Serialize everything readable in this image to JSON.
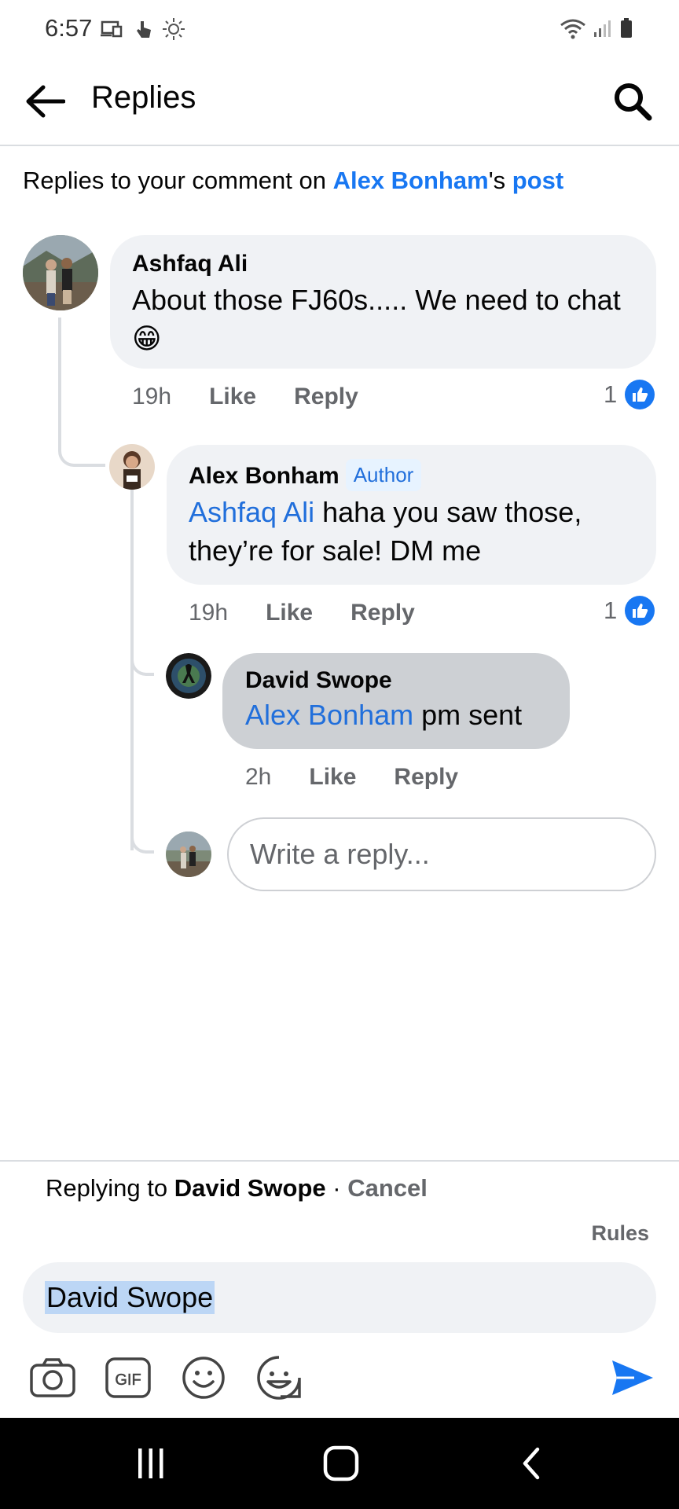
{
  "status_bar": {
    "time": "6:57",
    "icons_left": [
      "screen-cast-icon",
      "touch-icon",
      "sun-icon"
    ],
    "icons_right": [
      "wifi-icon",
      "signal-icon",
      "battery-icon"
    ]
  },
  "header": {
    "title": "Replies",
    "back_icon": "arrow-left-icon",
    "search_icon": "search-icon"
  },
  "context": {
    "prefix": "Replies to your comment on ",
    "person": "Alex Bonham",
    "possessive": "'s ",
    "post_link": "post"
  },
  "comments": [
    {
      "author": "Ashfaq Ali",
      "text": "About those FJ60s..... We need to chat",
      "emoji": "😁",
      "time": "19h",
      "like_label": "Like",
      "reply_label": "Reply",
      "like_count": "1"
    },
    {
      "author": "Alex Bonham",
      "badge": "Author",
      "mention": "Ashfaq Ali",
      "text": " haha you saw those, they’re for sale! DM me",
      "time": "19h",
      "like_label": "Like",
      "reply_label": "Reply",
      "like_count": "1"
    },
    {
      "author": "David Swope",
      "mention": "Alex Bonham",
      "text": " pm sent",
      "time": "2h",
      "like_label": "Like",
      "reply_label": "Reply"
    }
  ],
  "reply_input": {
    "placeholder": "Write a reply..."
  },
  "composer": {
    "replying_prefix": "Replying to ",
    "replying_name": "David Swope",
    "separator": " · ",
    "cancel_label": "Cancel",
    "rules_label": "Rules",
    "input_value": "David Swope",
    "tools": [
      "camera-icon",
      "gif-icon",
      "emoji-icon",
      "sticker-icon"
    ],
    "send_icon": "send-icon"
  },
  "nav": {
    "buttons": [
      "recent-apps-icon",
      "home-icon",
      "back-icon"
    ]
  },
  "colors": {
    "accent": "#1877f2",
    "mention": "#216fdb",
    "bubble": "#f0f2f5",
    "highlight_bubble": "#cdd0d4",
    "secondary_text": "#65676b"
  }
}
